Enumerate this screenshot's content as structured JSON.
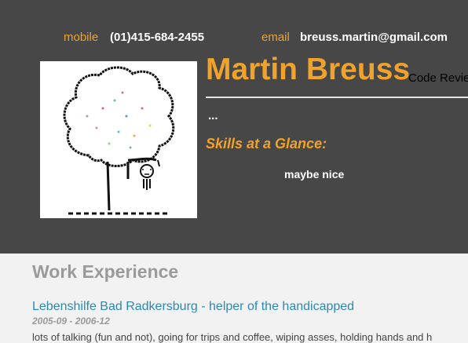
{
  "header": {
    "mobile_label": "mobile",
    "mobile_value": "(01)415-684-2455",
    "email_label": "email",
    "email_value": "breuss.martin@gmail.com",
    "name": "Martin Breuss",
    "subtitle": "Code Revie",
    "ellipsis": "...",
    "skills_heading": "Skills at a Glance:",
    "skills": [
      "maybe nice"
    ]
  },
  "photo": {
    "icon": "tree-drawing-icon"
  },
  "work": {
    "section_title": "Work Experience",
    "jobs": [
      {
        "title": "Lebenshilfe Bad Radkersburg - helper of the handicapped",
        "dates": "2005-09 - 2006-12",
        "description": "lots of talking (fun and not), going for trips and coffee, wiping asses, holding hands and h"
      }
    ]
  },
  "colors": {
    "header_bg": "#474747",
    "accent": "#f0a22a",
    "link": "#2a8ab5",
    "page_bg": "#f2f2f2"
  }
}
